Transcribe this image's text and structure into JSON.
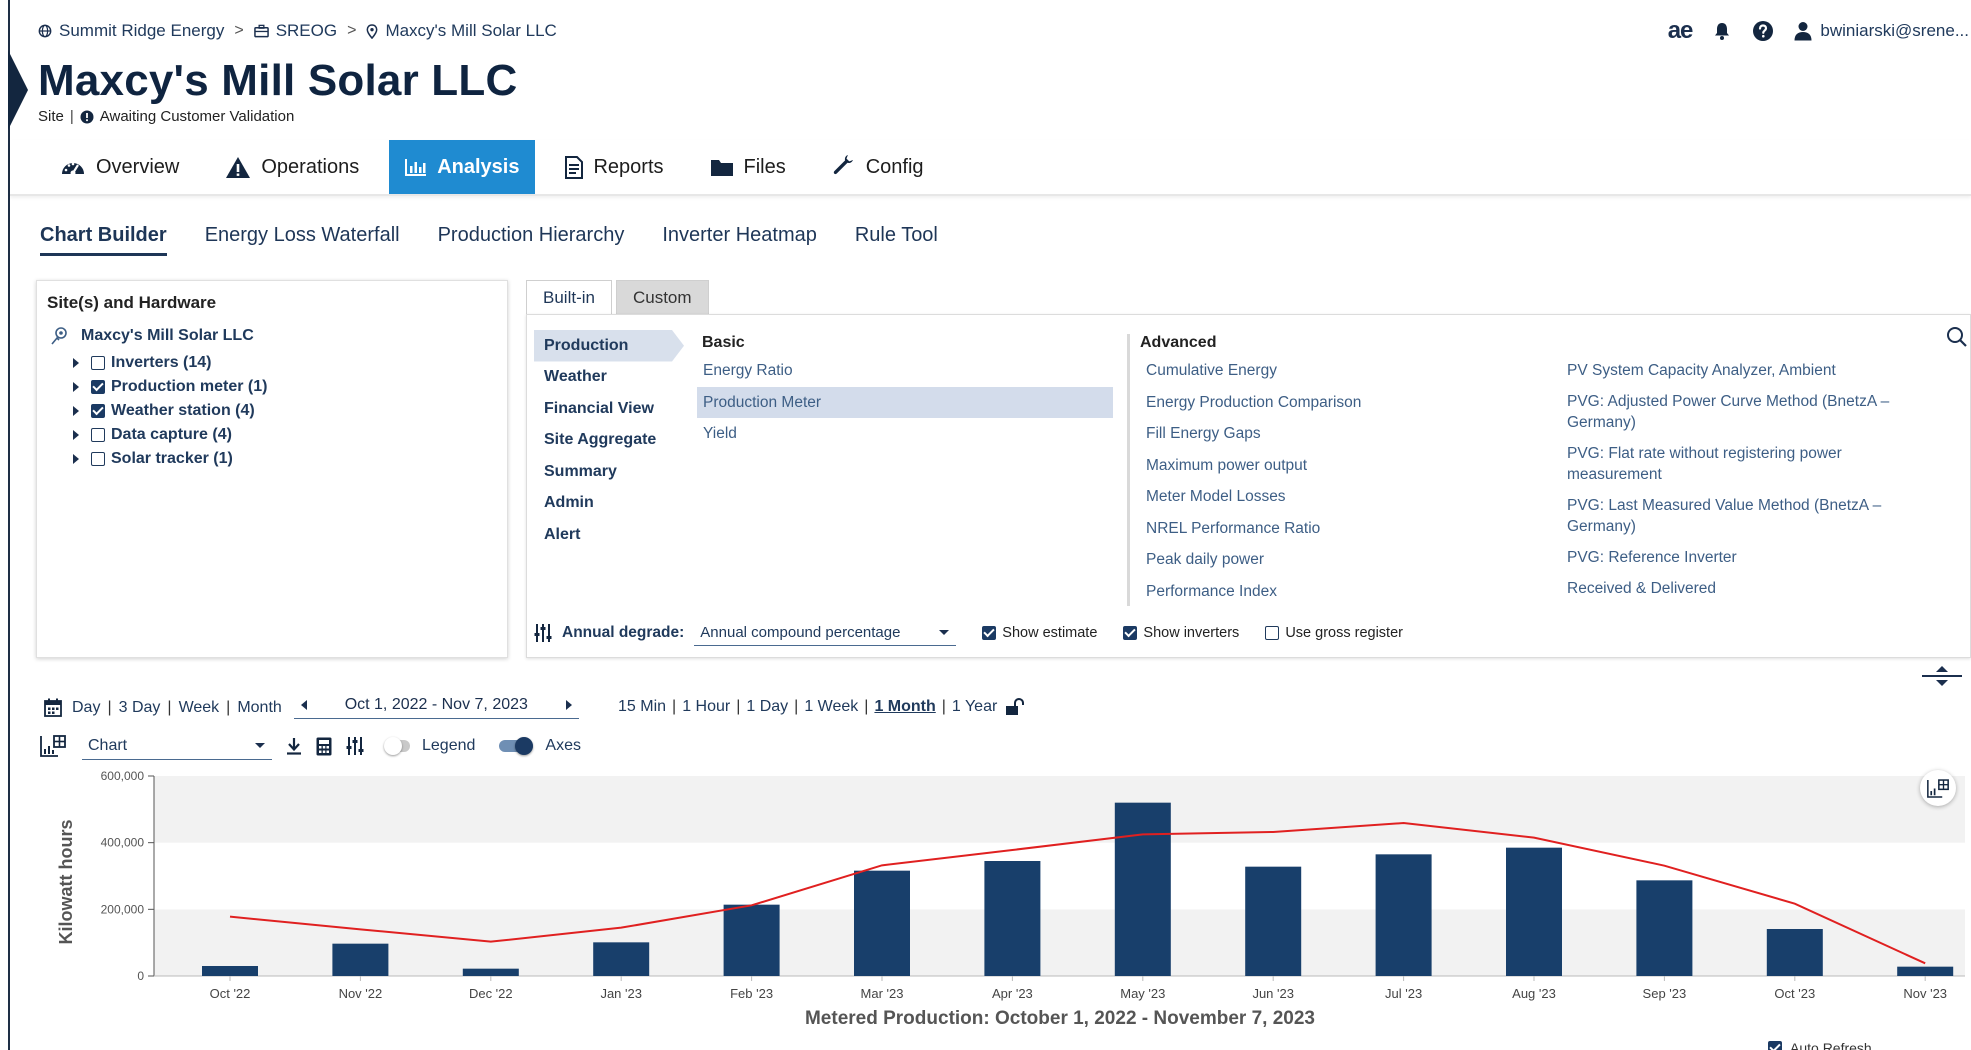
{
  "breadcrumb": {
    "items": [
      "Summit Ridge Energy",
      "SREOG",
      "Maxcy's Mill Solar LLC"
    ],
    "separator": ">"
  },
  "user": {
    "brand": "ae",
    "email": "bwiniarski@srene..."
  },
  "site": {
    "title": "Maxcy's Mill Solar LLC",
    "type": "Site",
    "status": "Awaiting Customer Validation"
  },
  "main_tabs": [
    "Overview",
    "Operations",
    "Analysis",
    "Reports",
    "Files",
    "Config"
  ],
  "main_tab_active": "Analysis",
  "sub_tabs": [
    "Chart Builder",
    "Energy Loss Waterfall",
    "Production Hierarchy",
    "Inverter Heatmap",
    "Rule Tool"
  ],
  "sub_tab_active": "Chart Builder",
  "sites_panel": {
    "title": "Site(s) and Hardware",
    "root": "Maxcy's Mill Solar LLC",
    "items": [
      {
        "label": "Inverters (14)",
        "checked": false
      },
      {
        "label": "Production meter (1)",
        "checked": true
      },
      {
        "label": "Weather station (4)",
        "checked": true
      },
      {
        "label": "Data capture (4)",
        "checked": false
      },
      {
        "label": "Solar tracker (1)",
        "checked": false
      }
    ]
  },
  "panel_tabs": [
    "Built-in",
    "Custom"
  ],
  "categories": [
    "Production",
    "Weather",
    "Financial View",
    "Site Aggregate",
    "Summary",
    "Admin",
    "Alert"
  ],
  "category_active": "Production",
  "basic": {
    "header": "Basic",
    "items": [
      "Energy Ratio",
      "Production Meter",
      "Yield"
    ],
    "selected": "Production Meter"
  },
  "advanced": {
    "header": "Advanced",
    "col1": [
      "Cumulative Energy",
      "Energy Production Comparison",
      "Fill Energy Gaps",
      "Maximum power output",
      "Meter Model Losses",
      "NREL Performance Ratio",
      "Peak daily power",
      "Performance Index"
    ],
    "col2": [
      "PV System Capacity Analyzer, Ambient",
      "PVG: Adjusted Power Curve Method (BnetzA – Germany)",
      "PVG: Flat rate without registering power measurement",
      "PVG: Last Measured Value Method (BnetzA – Germany)",
      "PVG: Reference Inverter",
      "Received & Delivered"
    ]
  },
  "options": {
    "degrade_label": "Annual degrade:",
    "degrade_value": "Annual compound percentage",
    "show_estimate": {
      "label": "Show estimate",
      "checked": true
    },
    "show_inverters": {
      "label": "Show inverters",
      "checked": true
    },
    "use_gross": {
      "label": "Use gross register",
      "checked": false
    }
  },
  "range": {
    "presets": [
      "Day",
      "3 Day",
      "Week",
      "Month"
    ],
    "dates": "Oct 1, 2022 - Nov 7, 2023",
    "intervals": [
      "15 Min",
      "1 Hour",
      "1 Day",
      "1 Week",
      "1 Month",
      "1 Year"
    ],
    "interval_active": "1 Month"
  },
  "chart_controls": {
    "type_value": "Chart",
    "legend_label": "Legend",
    "legend_on": false,
    "axes_label": "Axes",
    "axes_on": true
  },
  "auto_refresh_label": "Auto Refresh",
  "colors": {
    "accent": "#1f8bd1",
    "bar": "#183f6b",
    "line": "#e02020",
    "navy": "#0f2440"
  },
  "chart_data": {
    "type": "bar",
    "title": "Metered Production: October 1, 2022 - November 7, 2023",
    "ylabel": "Kilowatt hours",
    "xlabel": "",
    "ylim": [
      0,
      600000
    ],
    "yticks": [
      0,
      200000,
      400000,
      600000
    ],
    "ytick_labels": [
      "0",
      "200,000",
      "400,000",
      "600,000"
    ],
    "categories": [
      "Oct '22",
      "Nov '22",
      "Dec '22",
      "Jan '23",
      "Feb '23",
      "Mar '23",
      "Apr '23",
      "May '23",
      "Jun '23",
      "Jul '23",
      "Aug '23",
      "Sep '23",
      "Oct '23",
      "Nov '23"
    ],
    "series": [
      {
        "type": "bar",
        "values": [
          30000,
          97000,
          22000,
          101000,
          214000,
          316000,
          345000,
          520000,
          328000,
          365000,
          385000,
          287000,
          141000,
          28000
        ]
      },
      {
        "type": "line",
        "values": [
          178000,
          140000,
          103000,
          145000,
          212000,
          332000,
          378000,
          425000,
          432000,
          459000,
          415000,
          331000,
          217000,
          38000
        ]
      }
    ],
    "grid": "alternating horizontal bands"
  }
}
